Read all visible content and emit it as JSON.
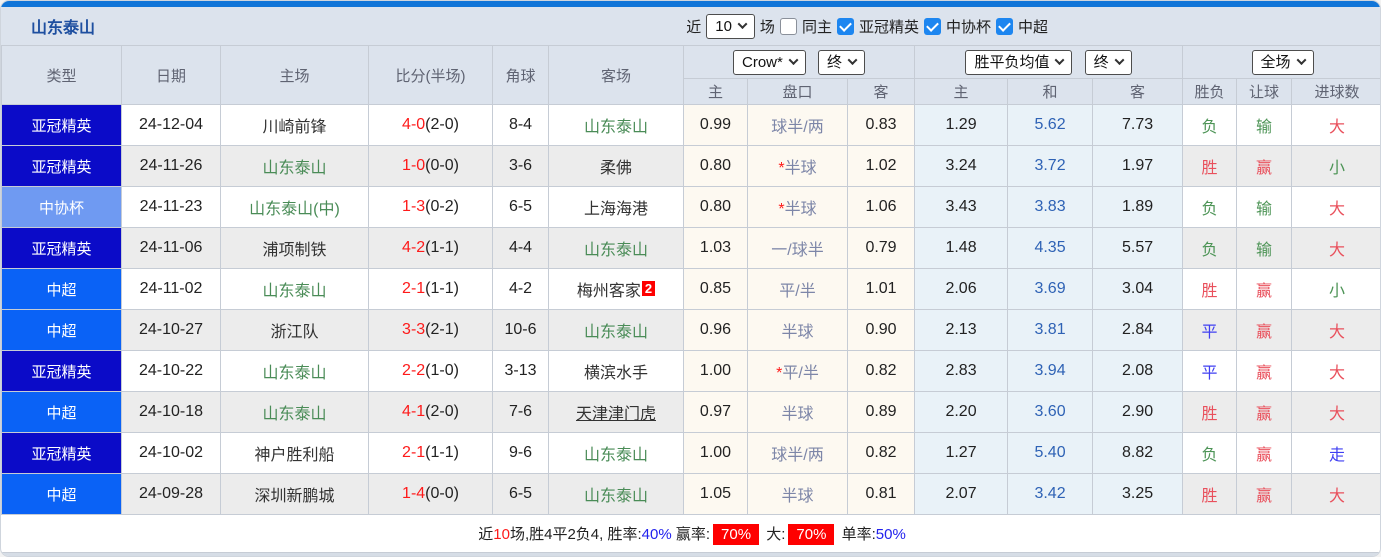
{
  "header": {
    "title": "山东泰山",
    "recent_label": "近",
    "recent_value": "10",
    "games_label": "场",
    "same_home_label": "同主",
    "same_home_checked": false,
    "filters": [
      {
        "label": "亚冠精英",
        "checked": true
      },
      {
        "label": "中协杯",
        "checked": true
      },
      {
        "label": "中超",
        "checked": true
      }
    ]
  },
  "colors": {
    "accent_bar": "#1175d8",
    "header_bg": "#dce3ed",
    "league": {
      "亚冠精英": "#0b0bc8",
      "中协杯": "#6f9af2",
      "中超": "#0a62f6"
    },
    "result": {
      "red": "#e9505c",
      "green": "#4d9456",
      "blue": "#3f3ff2"
    },
    "score_red": "#fe1a1a",
    "team_green": "#4a8c57",
    "handicap_text": "#7d86a8",
    "avg_draw_blue": "#2e62b5",
    "badge_red": "#fe0000"
  },
  "table": {
    "columns": {
      "type": "类型",
      "date": "日期",
      "home": "主场",
      "score": "比分(半场)",
      "corner": "角球",
      "away": "客场",
      "odds_home": "主",
      "odds_line": "盘口",
      "odds_away": "客",
      "avg_home": "主",
      "avg_draw": "和",
      "avg_away": "客",
      "result_wl": "胜负",
      "result_handicap": "让球",
      "result_goals": "进球数"
    },
    "dropdowns": {
      "bookmaker": "Crow*",
      "bookmaker_time": "终",
      "avg": "胜平负均值",
      "avg_time": "终",
      "scope": "全场"
    },
    "rows": [
      {
        "league": "亚冠精英",
        "date": "24-12-04",
        "home": "川崎前锋",
        "home_green": false,
        "score": "4-0",
        "half": "(2-0)",
        "corner": "8-4",
        "away": "山东泰山",
        "away_green": true,
        "away_badge": "",
        "away_underline": false,
        "odds_home": "0.99",
        "line_star": false,
        "line": "球半/两",
        "odds_away": "0.83",
        "avg_home": "1.29",
        "avg_draw": "5.62",
        "avg_away": "7.73",
        "wl": "负",
        "wl_c": "green",
        "hc": "输",
        "hc_c": "green",
        "goal": "大",
        "goal_c": "red"
      },
      {
        "league": "亚冠精英",
        "date": "24-11-26",
        "home": "山东泰山",
        "home_green": true,
        "score": "1-0",
        "half": "(0-0)",
        "corner": "3-6",
        "away": "柔佛",
        "away_green": false,
        "away_badge": "",
        "away_underline": false,
        "odds_home": "0.80",
        "line_star": true,
        "line": "半球",
        "odds_away": "1.02",
        "avg_home": "3.24",
        "avg_draw": "3.72",
        "avg_away": "1.97",
        "wl": "胜",
        "wl_c": "red",
        "hc": "赢",
        "hc_c": "red",
        "goal": "小",
        "goal_c": "green"
      },
      {
        "league": "中协杯",
        "date": "24-11-23",
        "home": "山东泰山(中)",
        "home_green": true,
        "score": "1-3",
        "half": "(0-2)",
        "corner": "6-5",
        "away": "上海海港",
        "away_green": false,
        "away_badge": "",
        "away_underline": false,
        "odds_home": "0.80",
        "line_star": true,
        "line": "半球",
        "odds_away": "1.06",
        "avg_home": "3.43",
        "avg_draw": "3.83",
        "avg_away": "1.89",
        "wl": "负",
        "wl_c": "green",
        "hc": "输",
        "hc_c": "green",
        "goal": "大",
        "goal_c": "red"
      },
      {
        "league": "亚冠精英",
        "date": "24-11-06",
        "home": "浦项制铁",
        "home_green": false,
        "score": "4-2",
        "half": "(1-1)",
        "corner": "4-4",
        "away": "山东泰山",
        "away_green": true,
        "away_badge": "",
        "away_underline": false,
        "odds_home": "1.03",
        "line_star": false,
        "line": "一/球半",
        "odds_away": "0.79",
        "avg_home": "1.48",
        "avg_draw": "4.35",
        "avg_away": "5.57",
        "wl": "负",
        "wl_c": "green",
        "hc": "输",
        "hc_c": "green",
        "goal": "大",
        "goal_c": "red"
      },
      {
        "league": "中超",
        "date": "24-11-02",
        "home": "山东泰山",
        "home_green": true,
        "score": "2-1",
        "half": "(1-1)",
        "corner": "4-2",
        "away": "梅州客家",
        "away_green": false,
        "away_badge": "2",
        "away_underline": false,
        "odds_home": "0.85",
        "line_star": false,
        "line": "平/半",
        "odds_away": "1.01",
        "avg_home": "2.06",
        "avg_draw": "3.69",
        "avg_away": "3.04",
        "wl": "胜",
        "wl_c": "red",
        "hc": "赢",
        "hc_c": "red",
        "goal": "小",
        "goal_c": "green"
      },
      {
        "league": "中超",
        "date": "24-10-27",
        "home": "浙江队",
        "home_green": false,
        "score": "3-3",
        "half": "(2-1)",
        "corner": "10-6",
        "away": "山东泰山",
        "away_green": true,
        "away_badge": "",
        "away_underline": false,
        "odds_home": "0.96",
        "line_star": false,
        "line": "半球",
        "odds_away": "0.90",
        "avg_home": "2.13",
        "avg_draw": "3.81",
        "avg_away": "2.84",
        "wl": "平",
        "wl_c": "blue",
        "hc": "赢",
        "hc_c": "red",
        "goal": "大",
        "goal_c": "red"
      },
      {
        "league": "亚冠精英",
        "date": "24-10-22",
        "home": "山东泰山",
        "home_green": true,
        "score": "2-2",
        "half": "(1-0)",
        "corner": "3-13",
        "away": "横滨水手",
        "away_green": false,
        "away_badge": "",
        "away_underline": false,
        "odds_home": "1.00",
        "line_star": true,
        "line": "平/半",
        "odds_away": "0.82",
        "avg_home": "2.83",
        "avg_draw": "3.94",
        "avg_away": "2.08",
        "wl": "平",
        "wl_c": "blue",
        "hc": "赢",
        "hc_c": "red",
        "goal": "大",
        "goal_c": "red"
      },
      {
        "league": "中超",
        "date": "24-10-18",
        "home": "山东泰山",
        "home_green": true,
        "score": "4-1",
        "half": "(2-0)",
        "corner": "7-6",
        "away": "天津津门虎",
        "away_green": false,
        "away_badge": "",
        "away_underline": true,
        "odds_home": "0.97",
        "line_star": false,
        "line": "半球",
        "odds_away": "0.89",
        "avg_home": "2.20",
        "avg_draw": "3.60",
        "avg_away": "2.90",
        "wl": "胜",
        "wl_c": "red",
        "hc": "赢",
        "hc_c": "red",
        "goal": "大",
        "goal_c": "red"
      },
      {
        "league": "亚冠精英",
        "date": "24-10-02",
        "home": "神户胜利船",
        "home_green": false,
        "score": "2-1",
        "half": "(1-1)",
        "corner": "9-6",
        "away": "山东泰山",
        "away_green": true,
        "away_badge": "",
        "away_underline": false,
        "odds_home": "1.00",
        "line_star": false,
        "line": "球半/两",
        "odds_away": "0.82",
        "avg_home": "1.27",
        "avg_draw": "5.40",
        "avg_away": "8.82",
        "wl": "负",
        "wl_c": "green",
        "hc": "赢",
        "hc_c": "red",
        "goal": "走",
        "goal_c": "blue"
      },
      {
        "league": "中超",
        "date": "24-09-28",
        "home": "深圳新鹏城",
        "home_green": false,
        "score": "1-4",
        "half": "(0-0)",
        "corner": "6-5",
        "away": "山东泰山",
        "away_green": true,
        "away_badge": "",
        "away_underline": false,
        "odds_home": "1.05",
        "line_star": false,
        "line": "半球",
        "odds_away": "0.81",
        "avg_home": "2.07",
        "avg_draw": "3.42",
        "avg_away": "3.25",
        "wl": "胜",
        "wl_c": "red",
        "hc": "赢",
        "hc_c": "red",
        "goal": "大",
        "goal_c": "red"
      }
    ]
  },
  "footer": {
    "segments": [
      {
        "text": "近",
        "style": "plain"
      },
      {
        "text": "10",
        "style": "red"
      },
      {
        "text": "场,胜4平2负4, 胜率:",
        "style": "plain"
      },
      {
        "text": "40%",
        "style": "blue"
      },
      {
        "text": " 赢率:",
        "style": "plain"
      },
      {
        "text": "70%",
        "style": "red-badge"
      },
      {
        "text": " 大:",
        "style": "plain"
      },
      {
        "text": "70%",
        "style": "red-badge"
      },
      {
        "text": " 单率:",
        "style": "plain"
      },
      {
        "text": "50%",
        "style": "blue"
      }
    ]
  }
}
